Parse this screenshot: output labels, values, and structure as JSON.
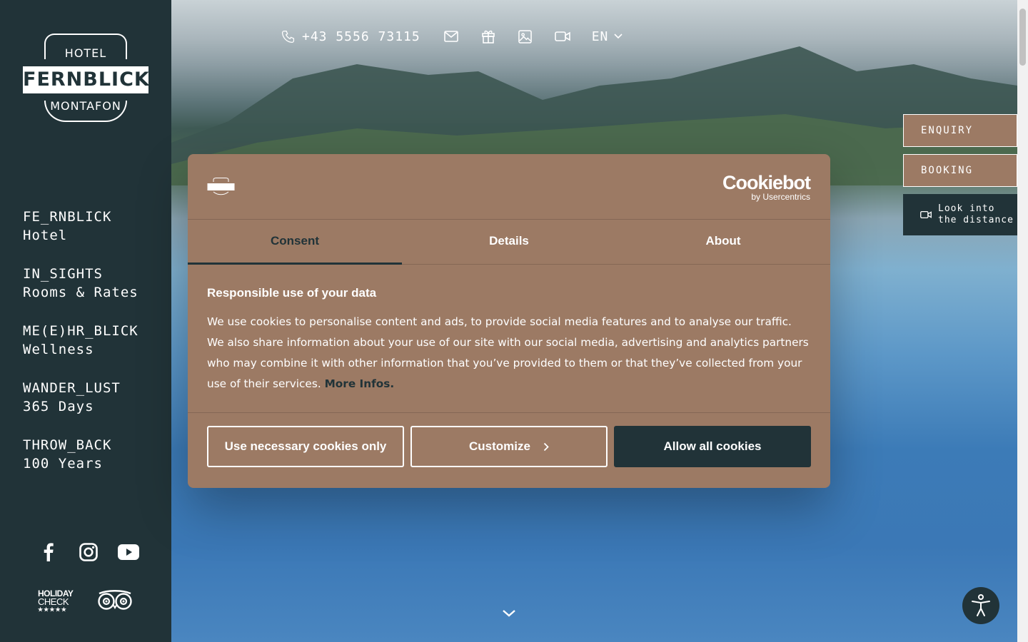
{
  "sidebar": {
    "logo": {
      "top": "HOTEL",
      "main": "FERNBLICK",
      "bottom": "MONTAFON"
    },
    "nav": [
      {
        "line1": "FE_RNBLICK",
        "line2": "Hotel"
      },
      {
        "line1": "IN_SIGHTS",
        "line2": "Rooms & Rates"
      },
      {
        "line1": "ME(E)HR_BLICK",
        "line2": "Wellness"
      },
      {
        "line1": "WANDER_LUST",
        "line2": "365 Days"
      },
      {
        "line1": "THROW_BACK",
        "line2": "100 Years"
      }
    ],
    "social": [
      "facebook-icon",
      "instagram-icon",
      "youtube-icon"
    ],
    "badges": {
      "holidaycheck_line1": "HOLIDAY",
      "holidaycheck_line2": "CHECK",
      "holidaycheck_stars": "★★★★★",
      "tripadvisor": "tripadvisor-icon"
    }
  },
  "topbar": {
    "phone": "+43 5556 73115",
    "icons": [
      "mail-icon",
      "gift-icon",
      "image-icon",
      "video-icon"
    ],
    "language": "EN"
  },
  "side_buttons": {
    "enquiry": "ENQUIRY",
    "booking": "BOOKING",
    "look_line1": "Look into",
    "look_line2": "the distance"
  },
  "cookie": {
    "mini_logo": "FERNBLICK",
    "brand": "Cookiebot",
    "brand_sub": "by Usercentrics",
    "tabs": [
      "Consent",
      "Details",
      "About"
    ],
    "active_tab": "Consent",
    "heading": "Responsible use of your data",
    "text": "We use cookies to personalise content and ads, to provide social media features and to analyse our traffic. We also share information about your use of our site with our social media, advertising and analytics partners who may combine it with other information that you’ve provided to them or that they’ve collected from your use of their services.",
    "more_link": "More Infos.",
    "buttons": {
      "necessary": "Use necessary cookies only",
      "customize": "Customize",
      "allow": "Allow all cookies"
    }
  },
  "colors": {
    "sidebar": "#213338",
    "accent": "#9c7a64",
    "primary_button": "#213338"
  }
}
